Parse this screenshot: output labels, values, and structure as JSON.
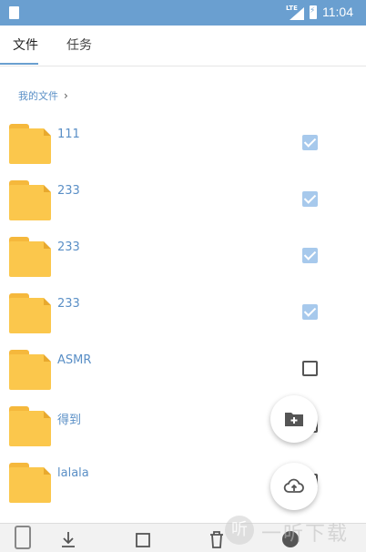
{
  "status_bar": {
    "network": "LTE",
    "time": "11:04"
  },
  "tabs": [
    {
      "label": "文件",
      "active": true
    },
    {
      "label": "任务",
      "active": false
    }
  ],
  "breadcrumb": {
    "label": "我的文件"
  },
  "files": [
    {
      "name": "111",
      "checked": true
    },
    {
      "name": "233",
      "checked": true
    },
    {
      "name": "233",
      "checked": true
    },
    {
      "name": "233",
      "checked": true
    },
    {
      "name": "ASMR",
      "checked": false
    },
    {
      "name": "得到",
      "checked": false
    },
    {
      "name": "lalala",
      "checked": false
    }
  ],
  "fabs": {
    "new_folder_icon": "folder-plus-icon",
    "upload_icon": "cloud-upload-icon"
  },
  "watermark": {
    "glyph": "听",
    "text": "一听下载"
  },
  "colors": {
    "accent": "#6a9fd0",
    "link": "#5a8fc6",
    "folder": "#fbc74c",
    "checkbox_on": "#a7c9ec"
  }
}
